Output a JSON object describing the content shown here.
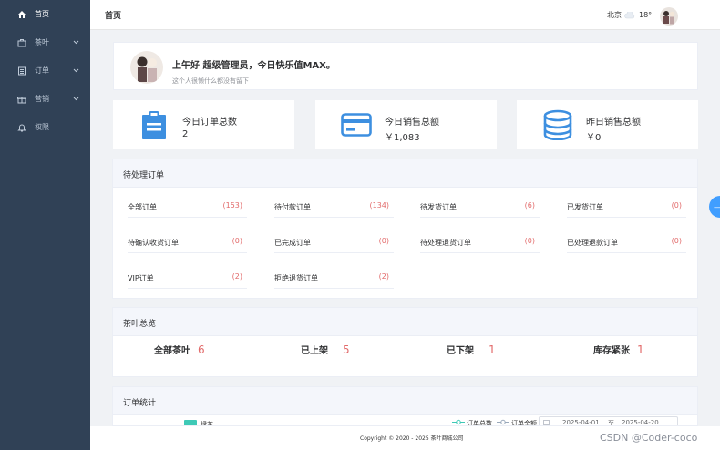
{
  "sidebar": {
    "items": [
      {
        "label": "首页",
        "icon": "home-icon",
        "active": true
      },
      {
        "label": "茶叶",
        "icon": "briefcase-icon"
      },
      {
        "label": "订单",
        "icon": "list-icon"
      },
      {
        "label": "营销",
        "icon": "gift-icon"
      },
      {
        "label": "权限",
        "icon": "bell-icon"
      }
    ]
  },
  "header": {
    "title": "首页",
    "city": "北京",
    "temperature": "18°"
  },
  "welcome": {
    "greeting": "上午好 超级管理员，今日快乐值MAX。",
    "signature": "这个人很懒什么都没有留下"
  },
  "stats": [
    {
      "label": "今日订单总数",
      "value": "2",
      "icon": "clipboard-icon"
    },
    {
      "label": "今日销售总额",
      "value": "￥1,083",
      "icon": "card-icon"
    },
    {
      "label": "昨日销售总额",
      "value": "￥0",
      "icon": "coins-icon"
    }
  ],
  "pending_orders": {
    "title": "待处理订单",
    "items": [
      {
        "label": "全部订单",
        "count": "(153)"
      },
      {
        "label": "待付款订单",
        "count": "(134)"
      },
      {
        "label": "待发货订单",
        "count": "(6)"
      },
      {
        "label": "已发货订单",
        "count": "(0)"
      },
      {
        "label": "待确认收货订单",
        "count": "(0)"
      },
      {
        "label": "已完成订单",
        "count": "(0)"
      },
      {
        "label": "待处理退货订单",
        "count": "(0)"
      },
      {
        "label": "已处理退款订单",
        "count": "(0)"
      },
      {
        "label": "VIP订单",
        "count": "(2)"
      },
      {
        "label": "拒绝退货订单",
        "count": "(2)"
      }
    ]
  },
  "tea_overview": {
    "title": "茶叶总览",
    "items": [
      {
        "label": "全部茶叶",
        "value": "6"
      },
      {
        "label": "已上架",
        "value": "5"
      },
      {
        "label": "已下架",
        "value": "1"
      },
      {
        "label": "库存紧张",
        "value": "1"
      }
    ]
  },
  "order_stats": {
    "title": "订单统计",
    "legend_left": "绿茶",
    "legend_total": "订单总数",
    "legend_amount": "订单金额",
    "date_start": "2025-04-01",
    "date_sep": "至",
    "date_end": "2025-04-20"
  },
  "footer": {
    "text": "Copyright © 2020 - 2025 茶叶商城公司"
  },
  "float_button": {
    "label": "—"
  },
  "watermark": {
    "text": "CSDN @Coder-coco"
  },
  "colors": {
    "sidebar": "#304156",
    "accent": "#409eff",
    "count_red": "#e26a6a",
    "legend_teal": "#3ec9b6"
  }
}
